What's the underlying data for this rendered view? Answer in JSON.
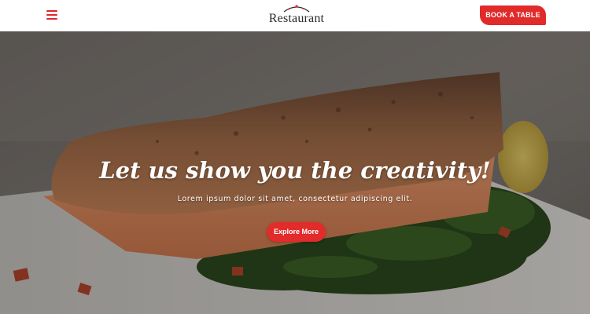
{
  "header": {
    "menu_icon": "hamburger-menu-icon",
    "logo_text": "Restaurant",
    "logo_icon": "cloche-icon",
    "book_button_label": "BOOK A TABLE"
  },
  "hero": {
    "title": "Let us show you the creativity!",
    "subtitle": "Lorem ipsum dolor sit amet, consectetur adipiscing elit.",
    "cta_label": "Explore More",
    "background_image": "grilled-salmon-on-spinach"
  },
  "colors": {
    "accent": "#e12a2a",
    "header_bg": "#ffffff",
    "text_light": "#ffffff",
    "logo_text": "#2a2a2a"
  }
}
